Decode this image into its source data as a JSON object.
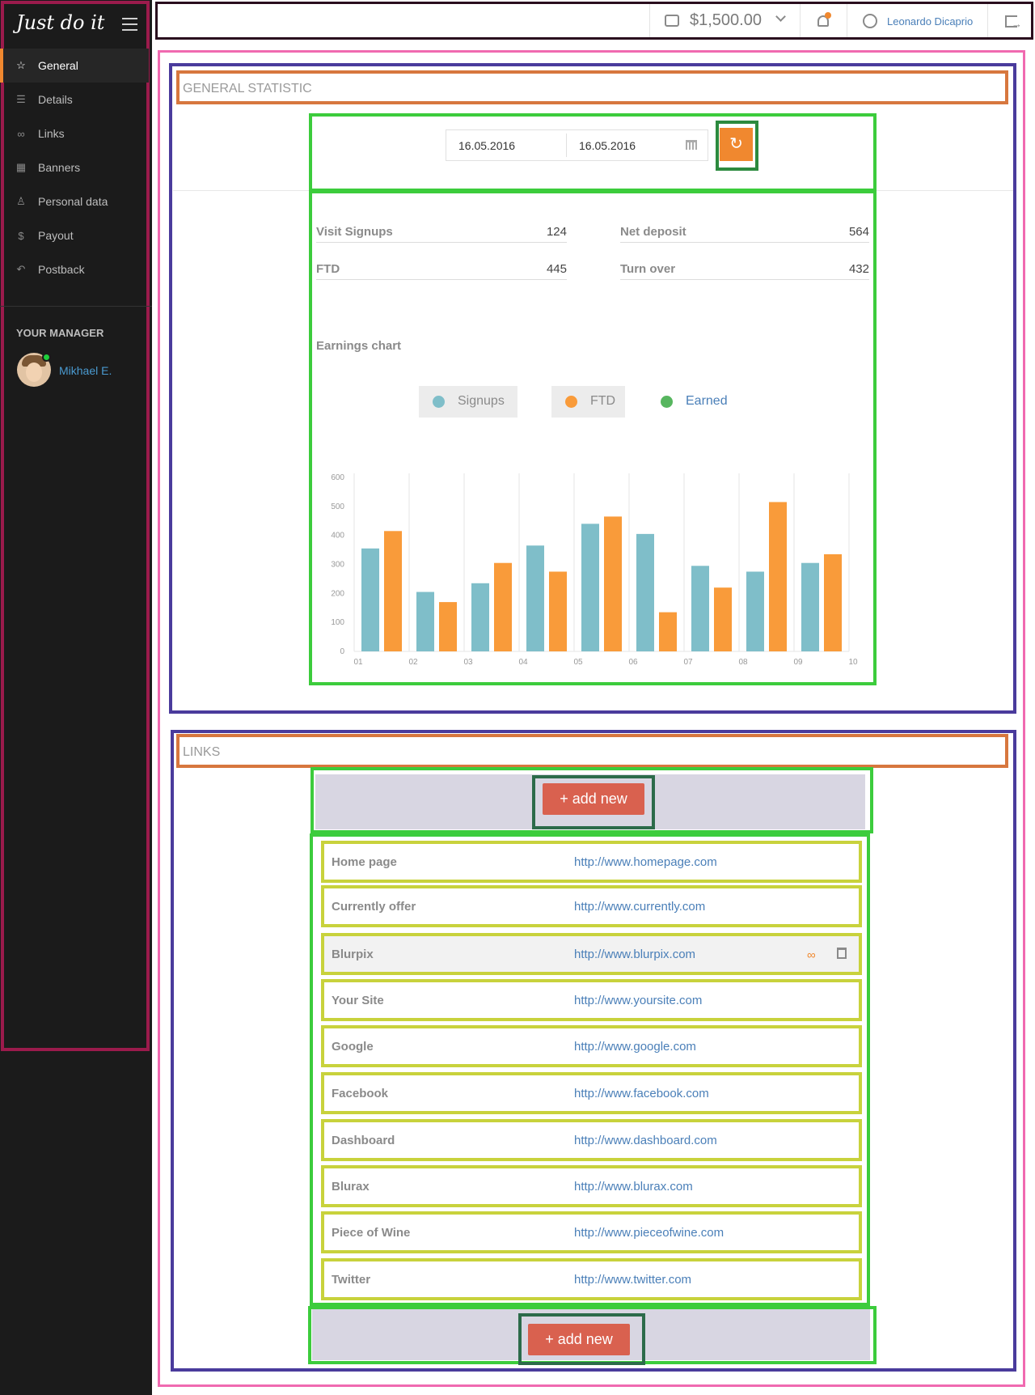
{
  "sidebar": {
    "logo": "Just do it",
    "items": [
      {
        "label": "General",
        "icon": "star-icon",
        "active": true
      },
      {
        "label": "Details",
        "icon": "list-icon"
      },
      {
        "label": "Links",
        "icon": "link-icon"
      },
      {
        "label": "Banners",
        "icon": "grid-icon"
      },
      {
        "label": "Personal data",
        "icon": "user-icon"
      },
      {
        "label": "Payout",
        "icon": "dollar-icon"
      },
      {
        "label": "Postback",
        "icon": "undo-icon"
      }
    ],
    "manager_title": "YOUR MANAGER",
    "manager_name": "Mikhael E."
  },
  "topbar": {
    "balance": "$1,500.00",
    "user_name": "Leonardo Dicaprio"
  },
  "general": {
    "title": "GENERAL STATISTIC",
    "date_from": "16.05.2016",
    "date_to": "16.05.2016",
    "stats": [
      {
        "label": "Visit Signups",
        "value": "124"
      },
      {
        "label": "Net deposit",
        "value": "564"
      },
      {
        "label": "FTD",
        "value": "445"
      },
      {
        "label": "Turn over",
        "value": "432"
      }
    ],
    "chart_title": "Earnings chart",
    "legend": [
      {
        "label": "Signups",
        "color": "#7fbec9"
      },
      {
        "label": "FTD",
        "color": "#f99b3a"
      },
      {
        "label": "Earned",
        "color": "#57b65f"
      }
    ]
  },
  "chart_data": {
    "type": "bar",
    "categories": [
      "01",
      "02",
      "03",
      "04",
      "05",
      "06",
      "07",
      "08",
      "09",
      "10"
    ],
    "series": [
      {
        "name": "Signups",
        "color": "#7fbec9",
        "values": [
          355,
          205,
          235,
          365,
          440,
          405,
          295,
          275,
          305
        ]
      },
      {
        "name": "FTD",
        "color": "#f99b3a",
        "values": [
          415,
          170,
          305,
          275,
          465,
          135,
          220,
          515,
          335
        ]
      }
    ],
    "ylim": [
      0,
      600
    ],
    "yticks": [
      0,
      100,
      200,
      300,
      400,
      500,
      600
    ],
    "grid": true
  },
  "links": {
    "title": "LINKS",
    "add_label": "+ add new",
    "rows": [
      {
        "name": "Home page",
        "url": "http://www.homepage.com"
      },
      {
        "name": "Currently offer",
        "url": "http://www.currently.com"
      },
      {
        "name": "Blurpix",
        "url": "http://www.blurpix.com"
      },
      {
        "name": "Your Site",
        "url": "http://www.yoursite.com"
      },
      {
        "name": "Google",
        "url": "http://www.google.com"
      },
      {
        "name": "Facebook",
        "url": "http://www.facebook.com"
      },
      {
        "name": "Dashboard",
        "url": "http://www.dashboard.com"
      },
      {
        "name": "Blurax",
        "url": "http://www.blurax.com"
      },
      {
        "name": "Piece of Wine",
        "url": "http://www.pieceofwine.com"
      },
      {
        "name": "Twitter",
        "url": "http://www.twitter.com"
      }
    ]
  }
}
